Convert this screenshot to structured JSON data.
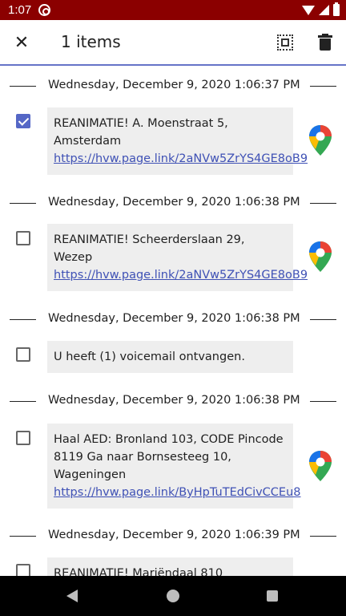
{
  "status_bar": {
    "time": "1:07"
  },
  "app_bar": {
    "close_icon": "close-icon",
    "title": "1 items",
    "select_all_icon": "select-all-icon",
    "delete_icon": "delete-icon"
  },
  "messages": [
    {
      "date": "Wednesday, December 9, 2020 1:06:37 PM",
      "checked": true,
      "text": "REANIMATIE! A. Moenstraat 5, Amsterdam ",
      "link": "https://hvw.page.link/2aNVw5ZrYS4GE8oB9",
      "has_map": true
    },
    {
      "date": "Wednesday, December 9, 2020 1:06:38 PM",
      "checked": false,
      "text": "REANIMATIE! Scheerderslaan 29, Wezep ",
      "link": "https://hvw.page.link/2aNVw5ZrYS4GE8oB9",
      "has_map": true
    },
    {
      "date": "Wednesday, December 9, 2020 1:06:38 PM",
      "checked": false,
      "text": "U heeft (1) voicemail ontvangen.",
      "link": "",
      "has_map": false
    },
    {
      "date": "Wednesday, December 9, 2020 1:06:38 PM",
      "checked": false,
      "text": "Haal AED: Bronland 103, CODE Pincode 8119 Ga naar Bornsesteeg 10, Wageningen ",
      "link": "https://hvw.page.link/ByHpTuTEdCivCCEu8",
      "has_map": true
    },
    {
      "date": "Wednesday, December 9, 2020 1:06:39 PM",
      "checked": false,
      "text": "REANIMATIE! Mariëndaal 810",
      "link": "",
      "has_map": false
    }
  ],
  "colors": {
    "status_bar": "#8b0000",
    "accent": "#5567c6",
    "link": "#3f51b5",
    "message_bg": "#eeeeee"
  }
}
